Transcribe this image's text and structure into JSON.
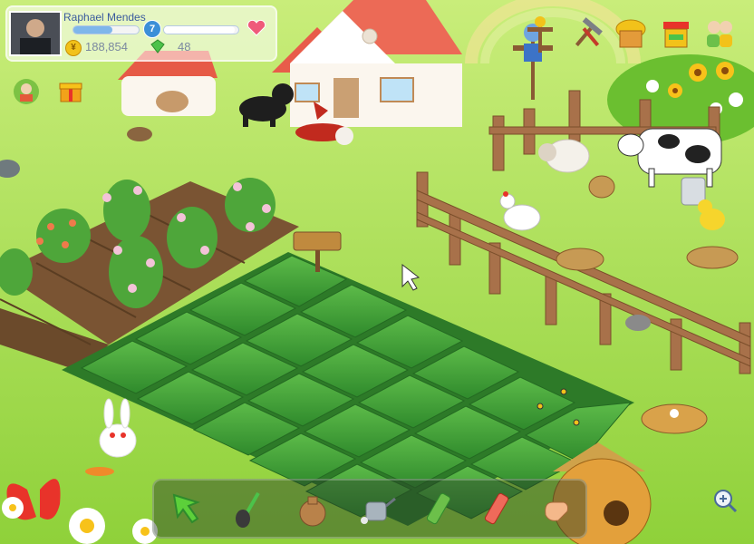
{
  "player": {
    "name": "Raphael Mendes",
    "level": "7",
    "coins": "188,854",
    "gems": "48",
    "coin_symbol": "¥"
  },
  "top_toolbar": {
    "items": [
      {
        "name": "scarecrow",
        "icon": "scarecrow-icon"
      },
      {
        "name": "tools",
        "icon": "hammer-icon"
      },
      {
        "name": "shop",
        "icon": "hut-icon"
      },
      {
        "name": "market",
        "icon": "market-stall-icon"
      },
      {
        "name": "friends",
        "icon": "friends-icon"
      }
    ]
  },
  "bottom_toolbar": {
    "tools": [
      {
        "name": "cursor",
        "icon": "arrow-cursor-icon"
      },
      {
        "name": "shovel",
        "icon": "shovel-icon"
      },
      {
        "name": "seed-bag",
        "icon": "seed-bag-icon"
      },
      {
        "name": "watering-can",
        "icon": "watering-can-icon"
      },
      {
        "name": "fertilizer",
        "icon": "fertilizer-tube-icon"
      },
      {
        "name": "pesticide",
        "icon": "pesticide-tube-icon"
      },
      {
        "name": "glove",
        "icon": "glove-icon"
      }
    ]
  },
  "colors": {
    "grass": "#8fd13a",
    "soil": "#6b4a2b",
    "crop": "#3f9e35",
    "fence": "#a8714a"
  }
}
